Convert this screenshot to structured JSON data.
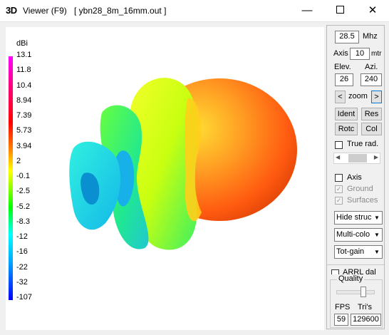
{
  "window": {
    "icon_text": "3D",
    "title": "Viewer (F9)",
    "file": "[  ybn28_8m_16mm.out ]",
    "minimize": "—",
    "close": "✕"
  },
  "scale": {
    "unit": "dBi",
    "ticks": [
      "13.1",
      "11.8",
      "10.4",
      "8.94",
      "7.39",
      "5.73",
      "3.94",
      "2",
      "-0.1",
      "-2.5",
      "-5.2",
      "-8.3",
      "-12",
      "-16",
      "-22",
      "-32",
      "-107"
    ]
  },
  "panel": {
    "freq_value": "28.5",
    "freq_unit": "Mhz",
    "axis_label": "Axis",
    "axis_value": "10",
    "axis_unit": "mtr",
    "elev_label": "Elev.",
    "azi_label": "Azi.",
    "elev_value": "26",
    "azi_value": "240",
    "zoom_prev": "<",
    "zoom_label": "zoom",
    "zoom_next": ">",
    "ident": "Ident",
    "res": "Res",
    "rotc": "Rotc",
    "col": "Col",
    "true_rad": "True rad.",
    "axis_chk": "Axis",
    "ground_chk": "Ground",
    "surfaces_chk": "Surfaces",
    "check_mark": "✓",
    "hide_struct": "Hide struc",
    "multi_color": "Multi-colo",
    "tot_gain": "Tot-gain",
    "hidden_chk": "ARRL dal",
    "quality": "Quality",
    "fps_label": "FPS",
    "fps_value": "59",
    "tris_label": "Tri's",
    "tris_value": "129600"
  }
}
